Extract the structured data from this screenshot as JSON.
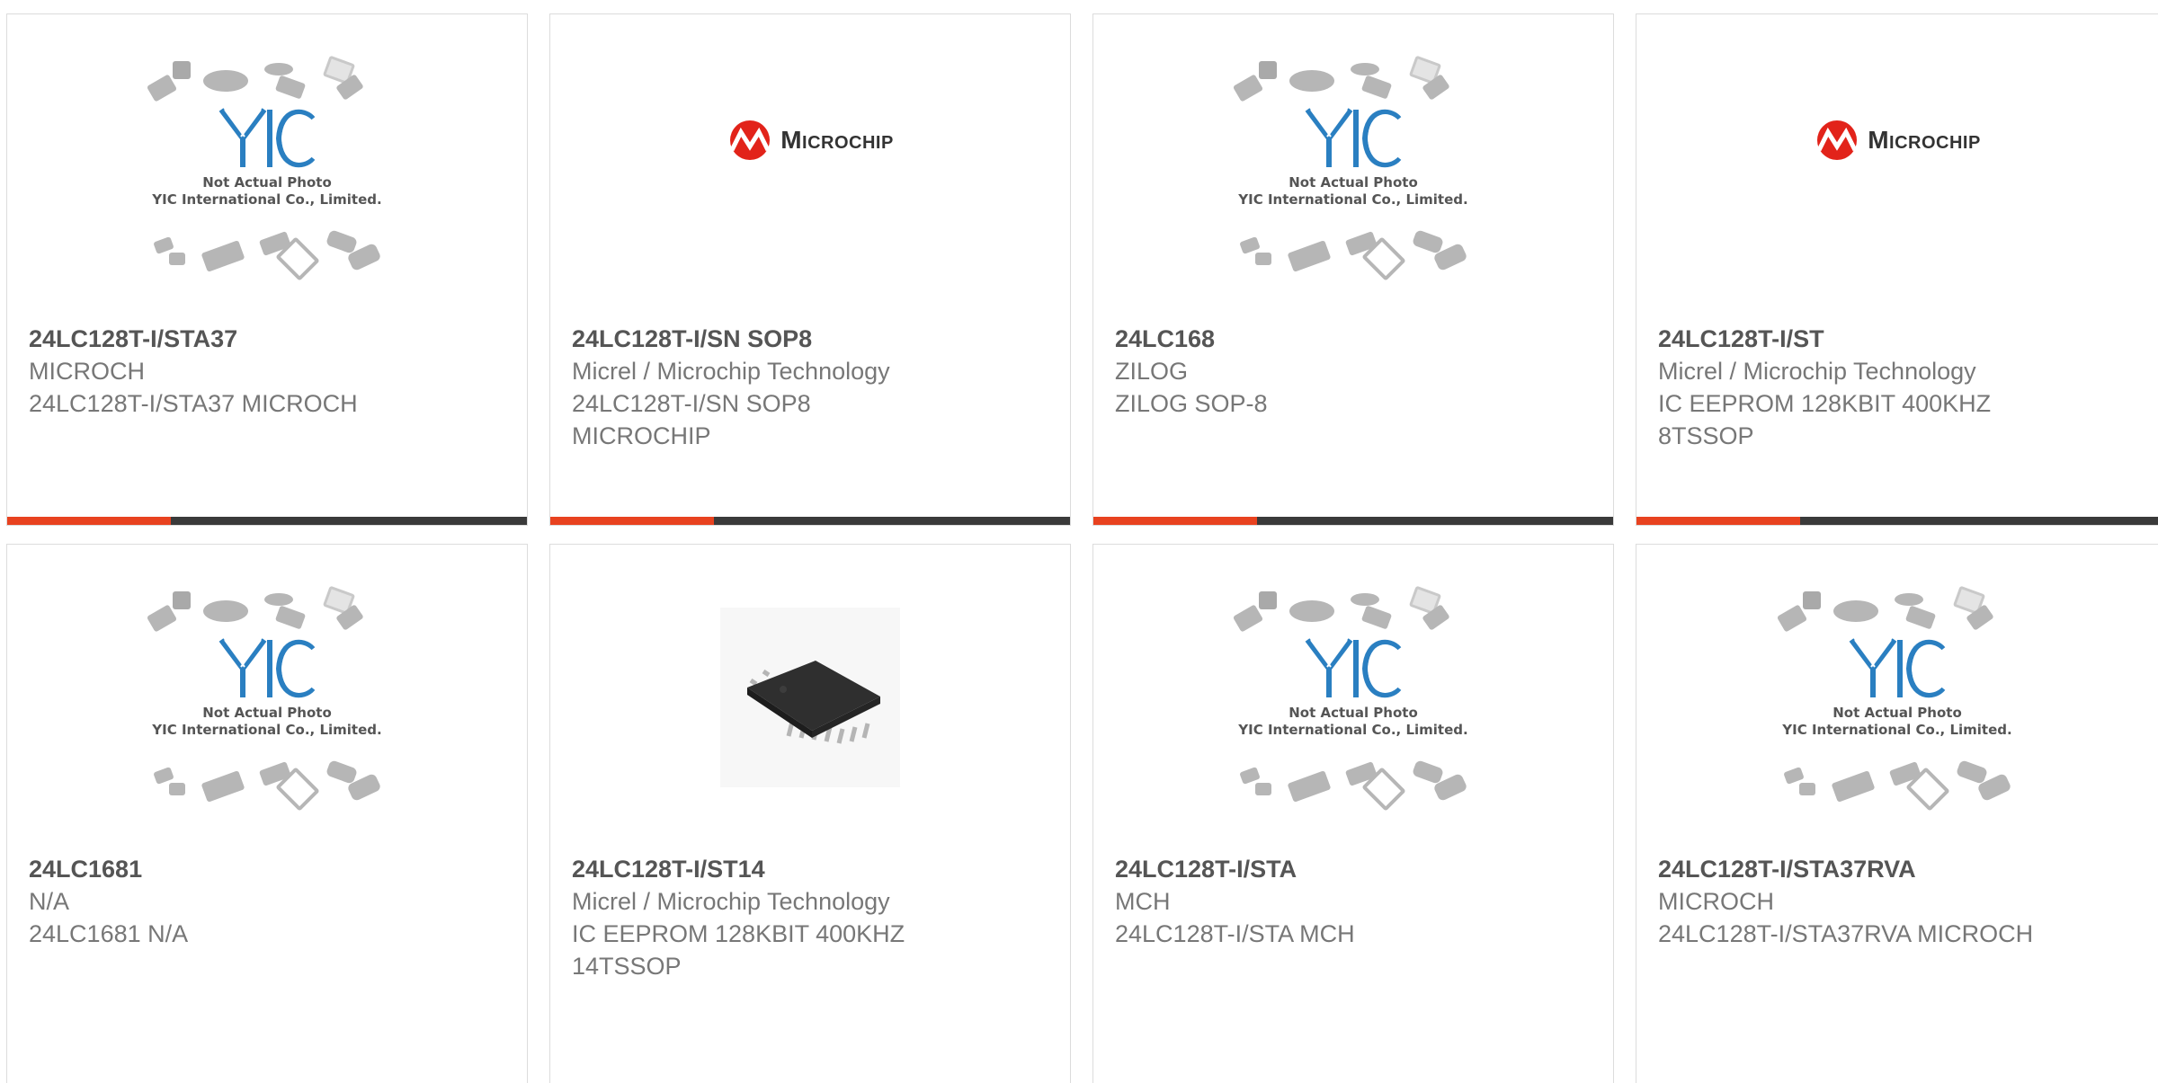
{
  "products": [
    {
      "part": "24LC128T-I/STA37",
      "manufacturer": "MICROCH",
      "description": "24LC128T-I/STA37 MICROCH",
      "image": "yic-placeholder",
      "image_text": [
        "Not Actual Photo",
        "YIC International Co., Limited."
      ]
    },
    {
      "part": "24LC128T-I/SN SOP8",
      "manufacturer": "Micrel / Microchip Technology",
      "description": "24LC128T-I/SN SOP8 MICROCHIP",
      "image": "microchip-logo",
      "image_text": [
        "Microchip"
      ]
    },
    {
      "part": "24LC168",
      "manufacturer": "ZILOG",
      "description": "ZILOG SOP-8",
      "image": "yic-placeholder",
      "image_text": [
        "Not Actual Photo",
        "YIC International Co., Limited."
      ]
    },
    {
      "part": "24LC128T-I/ST",
      "manufacturer": "Micrel / Microchip Technology",
      "description": "IC EEPROM 128KBIT 400KHZ 8TSSOP",
      "image": "microchip-logo",
      "image_text": [
        "Microchip"
      ]
    },
    {
      "part": "24LC1681",
      "manufacturer": "N/A",
      "description": "24LC1681 N/A",
      "image": "yic-placeholder",
      "image_text": [
        "Not Actual Photo",
        "YIC International Co., Limited."
      ]
    },
    {
      "part": "24LC128T-I/ST14",
      "manufacturer": "Micrel / Microchip Technology",
      "description": "IC EEPROM 128KBIT 400KHZ 14TSSOP",
      "image": "tssop-chip-photo"
    },
    {
      "part": "24LC128T-I/STA",
      "manufacturer": "MCH",
      "description": "24LC128T-I/STA MCH",
      "image": "yic-placeholder",
      "image_text": [
        "Not Actual Photo",
        "YIC International Co., Limited."
      ]
    },
    {
      "part": "24LC128T-I/STA37RVA",
      "manufacturer": "MICROCH",
      "description": "24LC128T-I/STA37RVA MICROCH",
      "image": "yic-placeholder",
      "image_text": [
        "Not Actual Photo",
        "YIC International Co., Limited."
      ]
    }
  ],
  "colors": {
    "accent": "#e8421f",
    "bar": "#3a3a3a",
    "yic_blue": "#2a7fc1",
    "microchip_red": "#e2231a"
  }
}
